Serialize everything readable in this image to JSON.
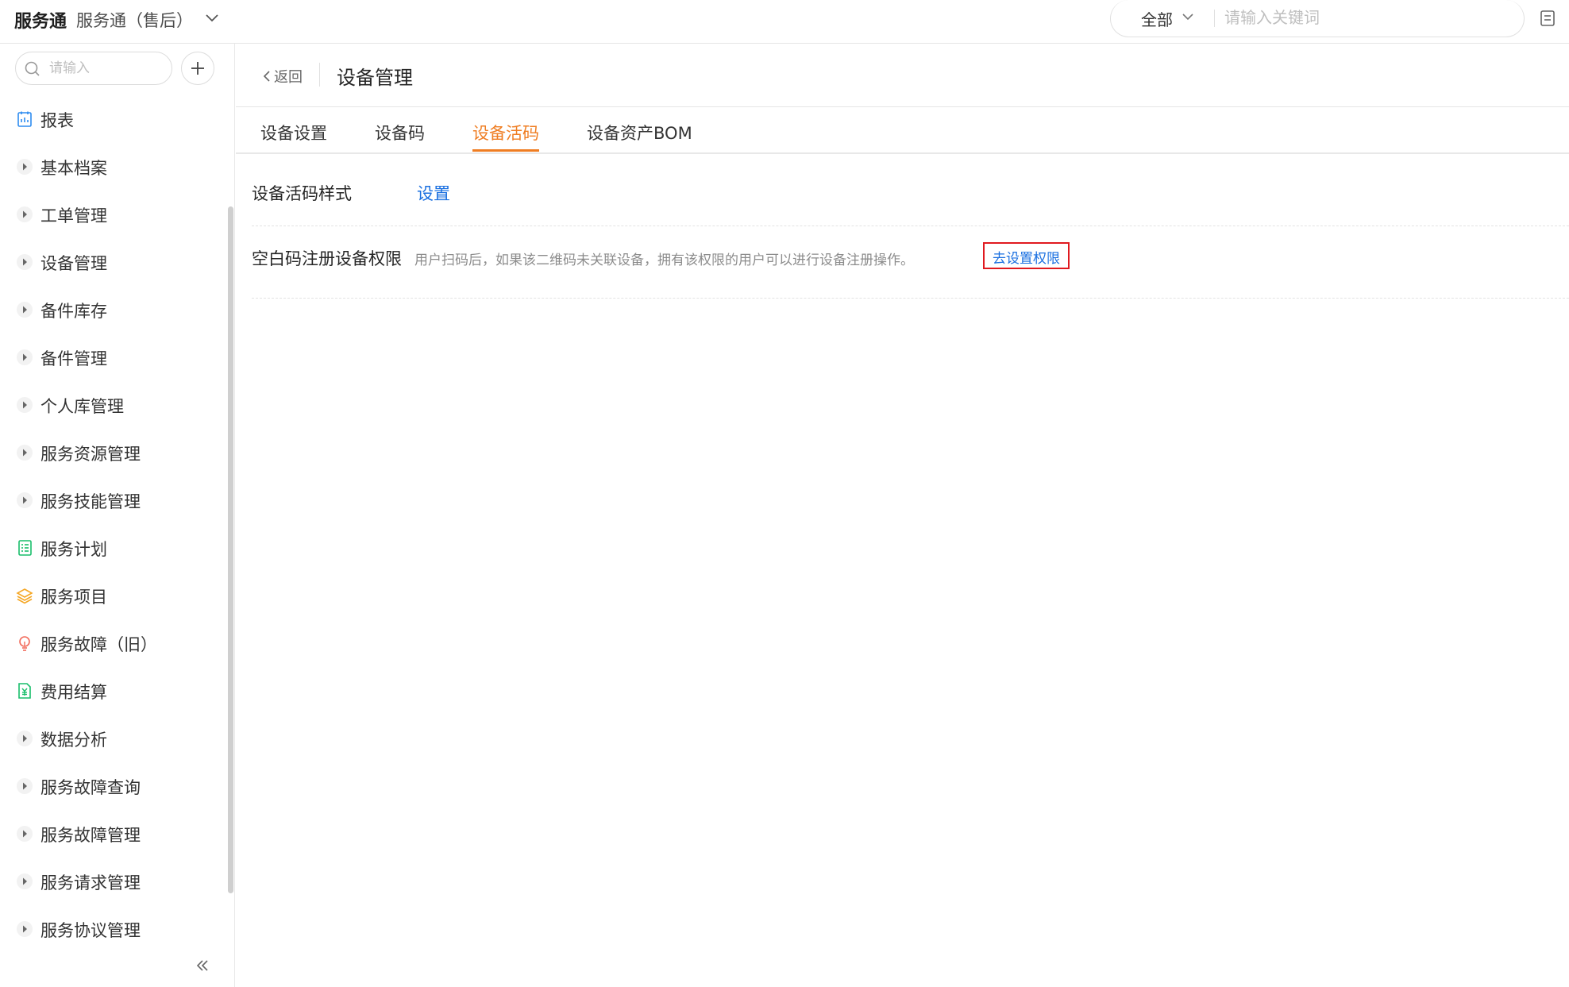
{
  "topbar": {
    "brand": "服务通",
    "app_name": "服务通（售后）",
    "search_scope": "全部",
    "search_placeholder": "请输入关键词"
  },
  "sidebar": {
    "search_placeholder": "请输入",
    "items": [
      {
        "label": "报表",
        "icon": "report-icon"
      },
      {
        "label": "基本档案",
        "icon": "caret-right-icon"
      },
      {
        "label": "工单管理",
        "icon": "caret-right-icon"
      },
      {
        "label": "设备管理",
        "icon": "caret-right-icon"
      },
      {
        "label": "备件库存",
        "icon": "caret-right-icon"
      },
      {
        "label": "备件管理",
        "icon": "caret-right-icon"
      },
      {
        "label": "个人库管理",
        "icon": "caret-right-icon"
      },
      {
        "label": "服务资源管理",
        "icon": "caret-right-icon"
      },
      {
        "label": "服务技能管理",
        "icon": "caret-right-icon"
      },
      {
        "label": "服务计划",
        "icon": "plan-list-icon"
      },
      {
        "label": "服务项目",
        "icon": "layers-icon"
      },
      {
        "label": "服务故障（旧）",
        "icon": "lightbulb-icon"
      },
      {
        "label": "费用结算",
        "icon": "yuan-document-icon"
      },
      {
        "label": "数据分析",
        "icon": "caret-right-icon"
      },
      {
        "label": "服务故障查询",
        "icon": "caret-right-icon"
      },
      {
        "label": "服务故障管理",
        "icon": "caret-right-icon"
      },
      {
        "label": "服务请求管理",
        "icon": "caret-right-icon"
      },
      {
        "label": "服务协议管理",
        "icon": "caret-right-icon"
      }
    ]
  },
  "header": {
    "back_label": "返回",
    "title": "设备管理"
  },
  "tabs": [
    {
      "label": "设备设置",
      "active": false
    },
    {
      "label": "设备码",
      "active": false
    },
    {
      "label": "设备活码",
      "active": true
    },
    {
      "label": "设备资产BOM",
      "active": false
    }
  ],
  "settings": {
    "style_row": {
      "label": "设备活码样式",
      "action": "设置"
    },
    "permission_row": {
      "label": "空白码注册设备权限",
      "description": "用户扫码后，如果该二维码未关联设备，拥有该权限的用户可以进行设备注册操作。",
      "action": "去设置权限"
    }
  },
  "colors": {
    "accent": "#ef7d22",
    "link": "#1a6fe0",
    "highlight_border": "#e0191f"
  }
}
